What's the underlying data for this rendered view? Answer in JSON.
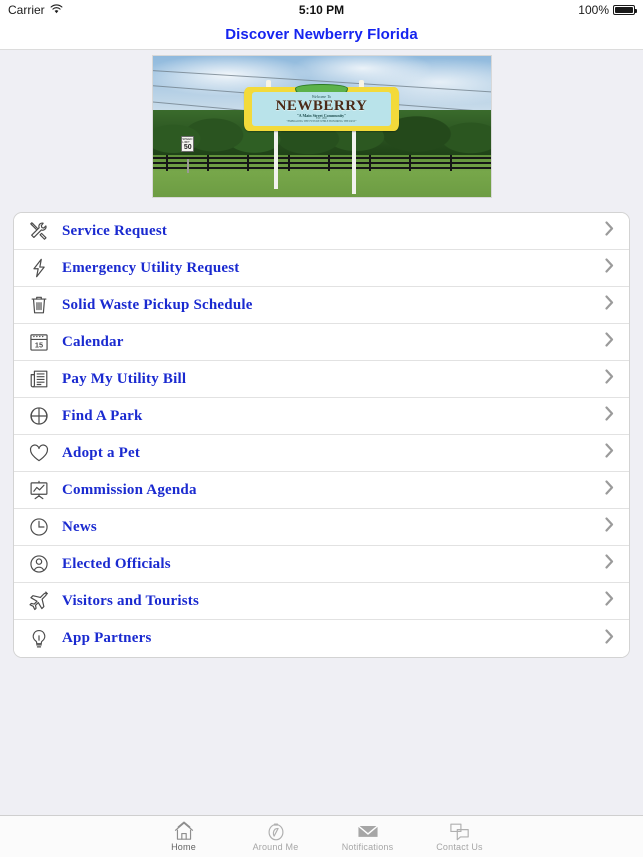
{
  "status_bar": {
    "carrier": "Carrier",
    "wifi_icon": "wifi-icon",
    "time": "5:10 PM",
    "battery_percent": "100%",
    "battery_icon": "battery-full-icon"
  },
  "nav": {
    "title": "Discover Newberry Florida",
    "title_color": "#1524ef"
  },
  "hero": {
    "name": "newberry-welcome-sign-photo",
    "sign_welcome": "Welcome To",
    "sign_name": "NEWBERRY",
    "sign_tagline": "\"A Main Street Community\"",
    "sign_established": "EST. 1895",
    "sign_motto": "\"EMBRACING THE FUTURE WHILE HONORING THE PAST\"",
    "speed_limit_label": "SPEED LIMIT",
    "speed_limit_value": "50"
  },
  "menu": {
    "accent_color": "#1a2ad0",
    "items": [
      {
        "label": "Service Request",
        "icon": "tools-icon",
        "name": "menu-item-service-request"
      },
      {
        "label": "Emergency Utility Request",
        "icon": "lightning-bolt-icon",
        "name": "menu-item-emergency-utility-request"
      },
      {
        "label": "Solid Waste Pickup Schedule",
        "icon": "trash-can-icon",
        "name": "menu-item-solid-waste-pickup-schedule"
      },
      {
        "label": "Calendar",
        "icon": "calendar-icon",
        "name": "menu-item-calendar",
        "icon_text": "15"
      },
      {
        "label": "Pay My Utility Bill",
        "icon": "newspaper-bill-icon",
        "name": "menu-item-pay-my-utility-bill"
      },
      {
        "label": "Find A Park",
        "icon": "basketball-icon",
        "name": "menu-item-find-a-park"
      },
      {
        "label": "Adopt a Pet",
        "icon": "heart-icon",
        "name": "menu-item-adopt-a-pet"
      },
      {
        "label": "Commission Agenda",
        "icon": "presentation-chart-icon",
        "name": "menu-item-commission-agenda"
      },
      {
        "label": "News",
        "icon": "clock-icon",
        "name": "menu-item-news"
      },
      {
        "label": "Elected Officials",
        "icon": "person-circle-icon",
        "name": "menu-item-elected-officials"
      },
      {
        "label": "Visitors and Tourists",
        "icon": "airplane-icon",
        "name": "menu-item-visitors-and-tourists"
      },
      {
        "label": "App Partners",
        "icon": "lightbulb-icon",
        "name": "menu-item-app-partners"
      }
    ],
    "chevron_icon": "chevron-right-icon"
  },
  "tabbar": {
    "items": [
      {
        "label": "Home",
        "icon": "home-icon",
        "active": true
      },
      {
        "label": "Around Me",
        "icon": "compass-icon",
        "active": false
      },
      {
        "label": "Notifications",
        "icon": "envelope-icon",
        "active": false
      },
      {
        "label": "Contact Us",
        "icon": "chat-bubbles-icon",
        "active": false
      }
    ]
  }
}
